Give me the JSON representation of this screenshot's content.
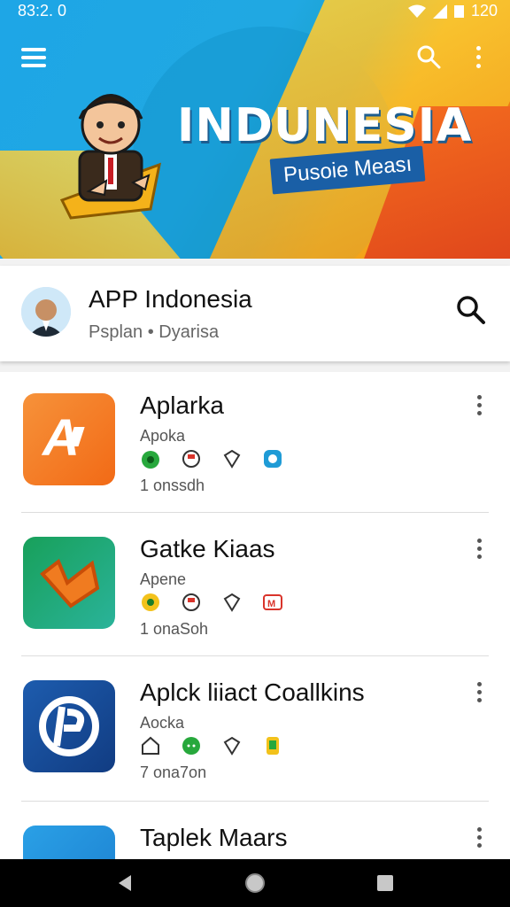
{
  "status_bar": {
    "time": "83:2. 0",
    "battery": "120"
  },
  "hero": {
    "title": "INDUNESIA",
    "tagline": "Pusoie Meası"
  },
  "app": {
    "title": "APP Indonesia",
    "subtitle": "Psplan • Dyarisa"
  },
  "list": [
    {
      "name": "Aplarka",
      "category": "Apoka",
      "size": "1 onssdh",
      "colors": [
        "#f47b20",
        "#fb9b2a"
      ]
    },
    {
      "name": "Gatke Kiaas",
      "category": "Apene",
      "size": "1 onaSoh",
      "colors": [
        "#12a05c",
        "#2fb58c"
      ]
    },
    {
      "name": "Aplck liiact Coallkins",
      "category": "Aocka",
      "size": "7 ona7on",
      "colors": [
        "#1a57a8",
        "#123f86"
      ]
    },
    {
      "name": "Taplek Maars",
      "category": "",
      "size": "",
      "colors": [
        "#2aa0e6",
        "#1c7fcf"
      ]
    }
  ],
  "icons": [
    "menu-icon",
    "search-icon",
    "more-vert-icon",
    "back-icon",
    "home-icon",
    "recents-icon"
  ]
}
